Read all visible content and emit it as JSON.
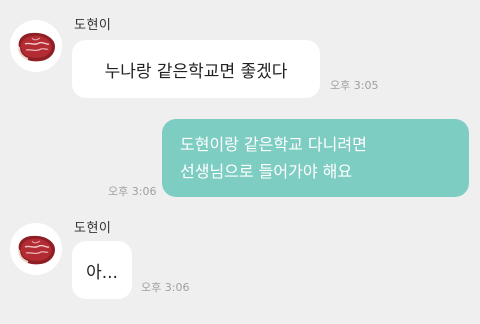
{
  "messages": [
    {
      "direction": "incoming",
      "sender": "도현이",
      "text": "누나랑 같은학교면 좋겠다",
      "time": "오후 3:05",
      "avatar_icon": "steak-icon"
    },
    {
      "direction": "outgoing",
      "lines": [
        "도현이랑 같은학교 다니려면",
        "선생님으로 들어가야 해요"
      ],
      "time": "오후 3:06"
    },
    {
      "direction": "incoming",
      "sender": "도현이",
      "text": "아...",
      "time": "오후 3:06",
      "avatar_icon": "steak-icon"
    }
  ],
  "colors": {
    "background": "#efefef",
    "incoming_bubble": "#ffffff",
    "outgoing_bubble": "#7ecdc3",
    "outgoing_text": "#ffffff",
    "timestamp": "#a0a0a0"
  }
}
